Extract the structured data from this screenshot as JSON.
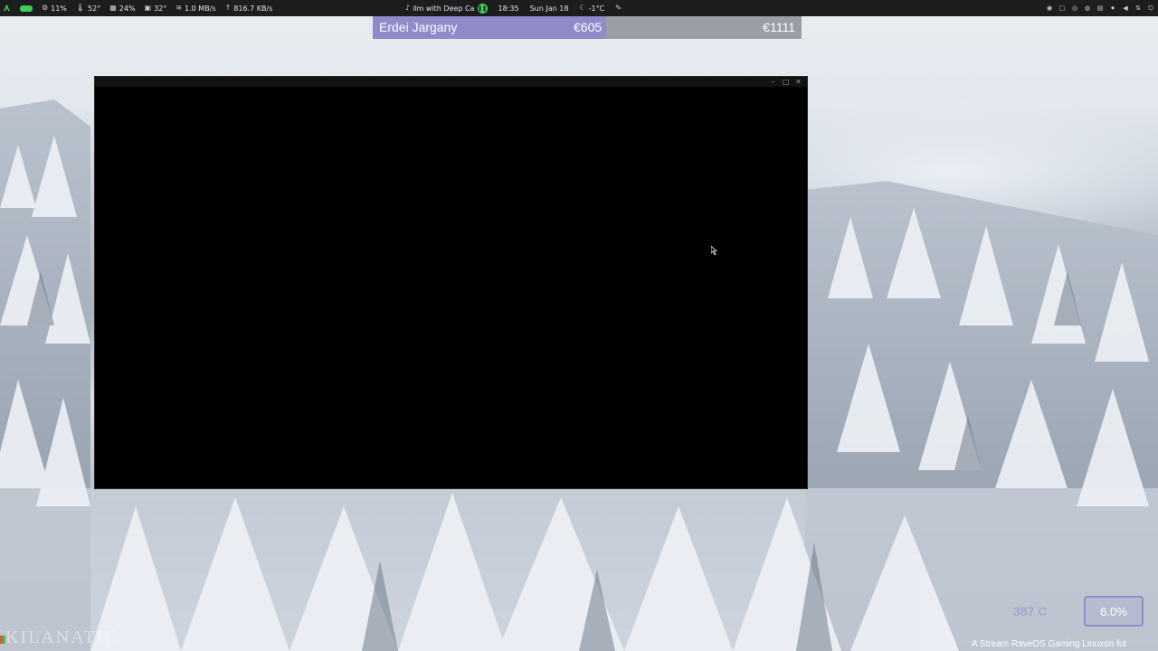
{
  "topbar": {
    "apps_icon": "apps-icon",
    "battery_color": "#3ccf54",
    "cpu": "11%",
    "temp1": "52°",
    "mem": "24%",
    "temp2": "32°",
    "download": "1.0 MB/s",
    "upload": "816.7 KB/s",
    "media_title": "ilm with Deep Ca",
    "time": "18:35",
    "date": "Sun Jan 18",
    "weather": "-1°C"
  },
  "overlay": {
    "name": "Erdei Jargany",
    "goal": "€605",
    "target": "€1111",
    "progress_fraction": 0.545,
    "progress_color": "#8f8bc9"
  },
  "bottom": {
    "watermark": "KILANATIC",
    "faint_value": "387 C",
    "cpu_percent": "6.0%",
    "ticker": "A Stream RaveOS Gaming Linuxon fut"
  },
  "colors": {
    "accent": "#3ccf54",
    "overlay_purple": "#8f8bc9"
  }
}
